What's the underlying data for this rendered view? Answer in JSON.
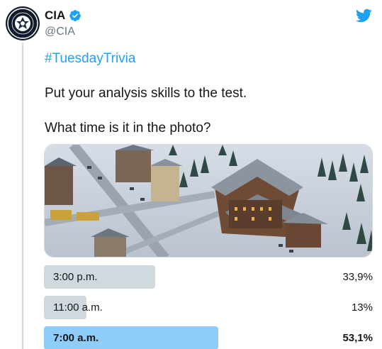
{
  "author": {
    "display_name": "CIA",
    "handle": "@CIA",
    "verified": true,
    "avatar": "cia-seal-avatar"
  },
  "tweet": {
    "hashtag": "#TuesdayTrivia",
    "line1": "Put your analysis skills to the test.",
    "line2": "What time is it in the photo?"
  },
  "media": {
    "icon": "winter-town-aerial-photo"
  },
  "poll": {
    "options": [
      {
        "label": "3:00 p.m.",
        "pct_text": "33,9%",
        "percent": 33.9,
        "winner": false
      },
      {
        "label": "11:00 a.m.",
        "pct_text": "13%",
        "percent": 13,
        "winner": false
      },
      {
        "label": "7:00 a.m.",
        "pct_text": "53,1%",
        "percent": 53.1,
        "winner": true
      }
    ]
  },
  "colors": {
    "link": "#1da1f2",
    "bar": "#cfd9de",
    "bar_winner": "#8ecdf8",
    "verified": "#1da1f2"
  }
}
